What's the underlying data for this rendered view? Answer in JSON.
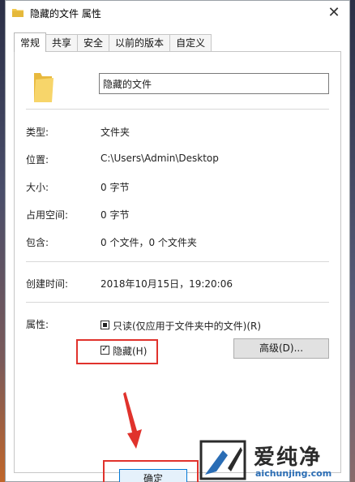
{
  "window": {
    "title": "隐藏的文件 属性",
    "close_glyph": "✕"
  },
  "tabs": [
    {
      "label": "常规",
      "active": true
    },
    {
      "label": "共享",
      "active": false
    },
    {
      "label": "安全",
      "active": false
    },
    {
      "label": "以前的版本",
      "active": false
    },
    {
      "label": "自定义",
      "active": false
    }
  ],
  "general": {
    "name": "隐藏的文件",
    "type_label": "类型:",
    "type_value": "文件夹",
    "location_label": "位置:",
    "location_value": "C:\\Users\\Admin\\Desktop",
    "size_label": "大小:",
    "size_value": "0 字节",
    "disk_size_label": "占用空间:",
    "disk_size_value": "0 字节",
    "contains_label": "包含:",
    "contains_value": "0 个文件，0 个文件夹",
    "created_label": "创建时间:",
    "created_value": "2018年10月15日，19:20:06",
    "attributes_label": "属性:",
    "readonly_label": "只读(仅应用于文件夹中的文件)(R)",
    "readonly_state": "indeterminate",
    "hidden_label": "隐藏(H)",
    "hidden_checked": true,
    "advanced_button": "高级(D)..."
  },
  "footer": {
    "ok_button": "确定"
  },
  "watermark": {
    "title": "爱纯净",
    "url": "aichunjing.com"
  },
  "colors": {
    "annotation_red": "#e0322c",
    "folder_yellow": "#f2c94c",
    "accent_blue": "#0078d7"
  },
  "icons": {
    "title_icon": "folder-icon",
    "big_icon": "folder-icon",
    "close": "close-icon"
  }
}
